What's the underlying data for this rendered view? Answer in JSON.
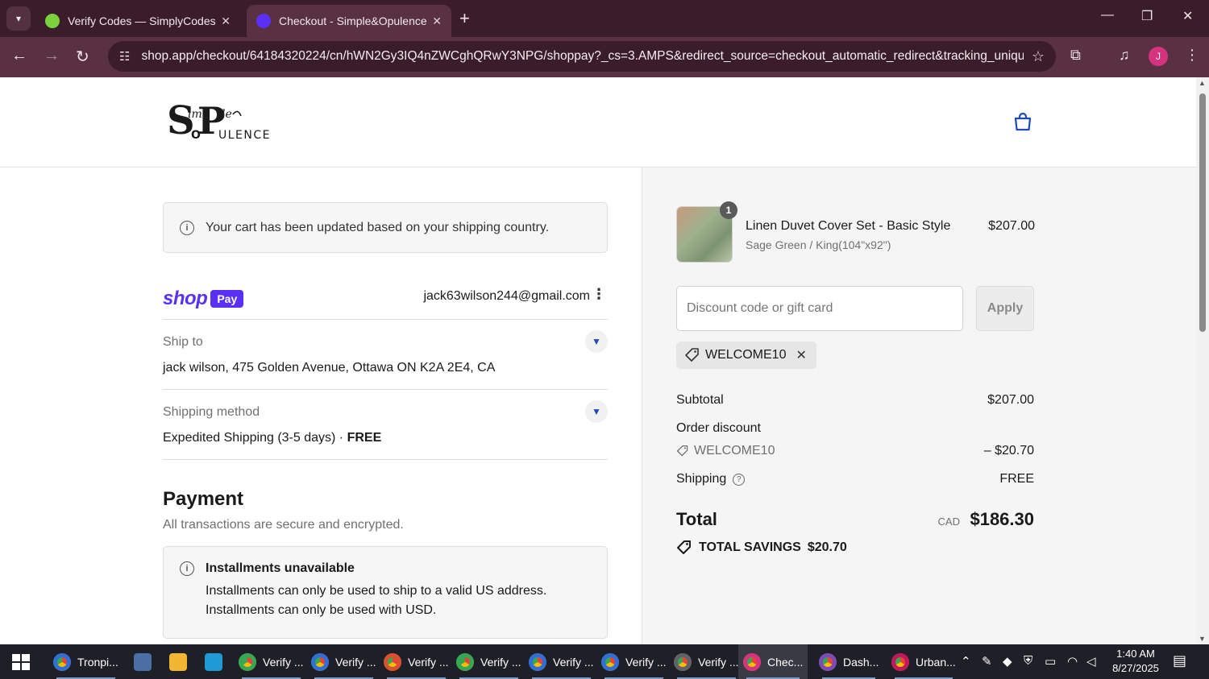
{
  "browser": {
    "tabs": [
      {
        "title": "Verify Codes — SimplyCodes",
        "active": false
      },
      {
        "title": "Checkout - Simple&Opulence",
        "active": true
      }
    ],
    "url": "shop.app/checkout/64184320224/cn/hWN2Gy3IQ4nZWCghQRwY3NPG/shoppay?_cs=3.AMPS&redirect_source=checkout_automatic_redirect&tracking_uniqu...",
    "profile_initial": "J"
  },
  "header": {
    "logo_alt": "Simple & Opulence"
  },
  "checkout": {
    "notice": "Your cart has been updated based on your shipping country.",
    "shoppay": {
      "shop": "shop",
      "pay": "Pay",
      "email": "jack63wilson244@gmail.com"
    },
    "ship_to": {
      "label": "Ship to",
      "value": "jack wilson, 475 Golden Avenue, Ottawa ON K2A 2E4, CA"
    },
    "shipping_method": {
      "label": "Shipping method",
      "value": "Expedited Shipping (3-5 days) · ",
      "price": "FREE"
    },
    "payment": {
      "title": "Payment",
      "subtitle": "All transactions are secure and encrypted.",
      "installments_title": "Installments unavailable",
      "installments_lines": [
        "Installments can only be used to ship to a valid US address.",
        "Installments can only be used with USD."
      ]
    }
  },
  "summary": {
    "item": {
      "quantity": "1",
      "name": "Linen Duvet Cover Set - Basic Style",
      "variant": "Sage Green / King(104\"x92\")",
      "price": "$207.00"
    },
    "discount_placeholder": "Discount code or gift card",
    "apply_label": "Apply",
    "applied_code": "WELCOME10",
    "subtotal_label": "Subtotal",
    "subtotal_value": "$207.00",
    "order_discount_label": "Order discount",
    "discount_code": "WELCOME10",
    "discount_value": "– $20.70",
    "shipping_label": "Shipping",
    "shipping_value": "FREE",
    "total_label": "Total",
    "currency": "CAD",
    "total_value": "$186.30",
    "savings_label": "TOTAL SAVINGS",
    "savings_value": "$20.70"
  },
  "taskbar": {
    "apps": [
      {
        "label": "Tronpi...",
        "icon_color": "#2f6fd6"
      },
      {
        "label": "Verify ...",
        "icon_color": "#34a853"
      },
      {
        "label": "Verify ...",
        "icon_color": "#2f6fd6"
      },
      {
        "label": "Verify ...",
        "icon_color": "#d8502e"
      },
      {
        "label": "Verify ...",
        "icon_color": "#34a853"
      },
      {
        "label": "Verify ...",
        "icon_color": "#2f6fd6"
      },
      {
        "label": "Verify ...",
        "icon_color": "#2f6fd6"
      },
      {
        "label": "Verify ...",
        "icon_color": "#5f6368"
      },
      {
        "label": "Chec...",
        "icon_color": "#d5337f"
      },
      {
        "label": "Dash...",
        "icon_color": "#7b4bb8"
      },
      {
        "label": "Urban...",
        "icon_color": "#c2185b"
      }
    ],
    "time": "1:40 AM",
    "date": "8/27/2025"
  }
}
